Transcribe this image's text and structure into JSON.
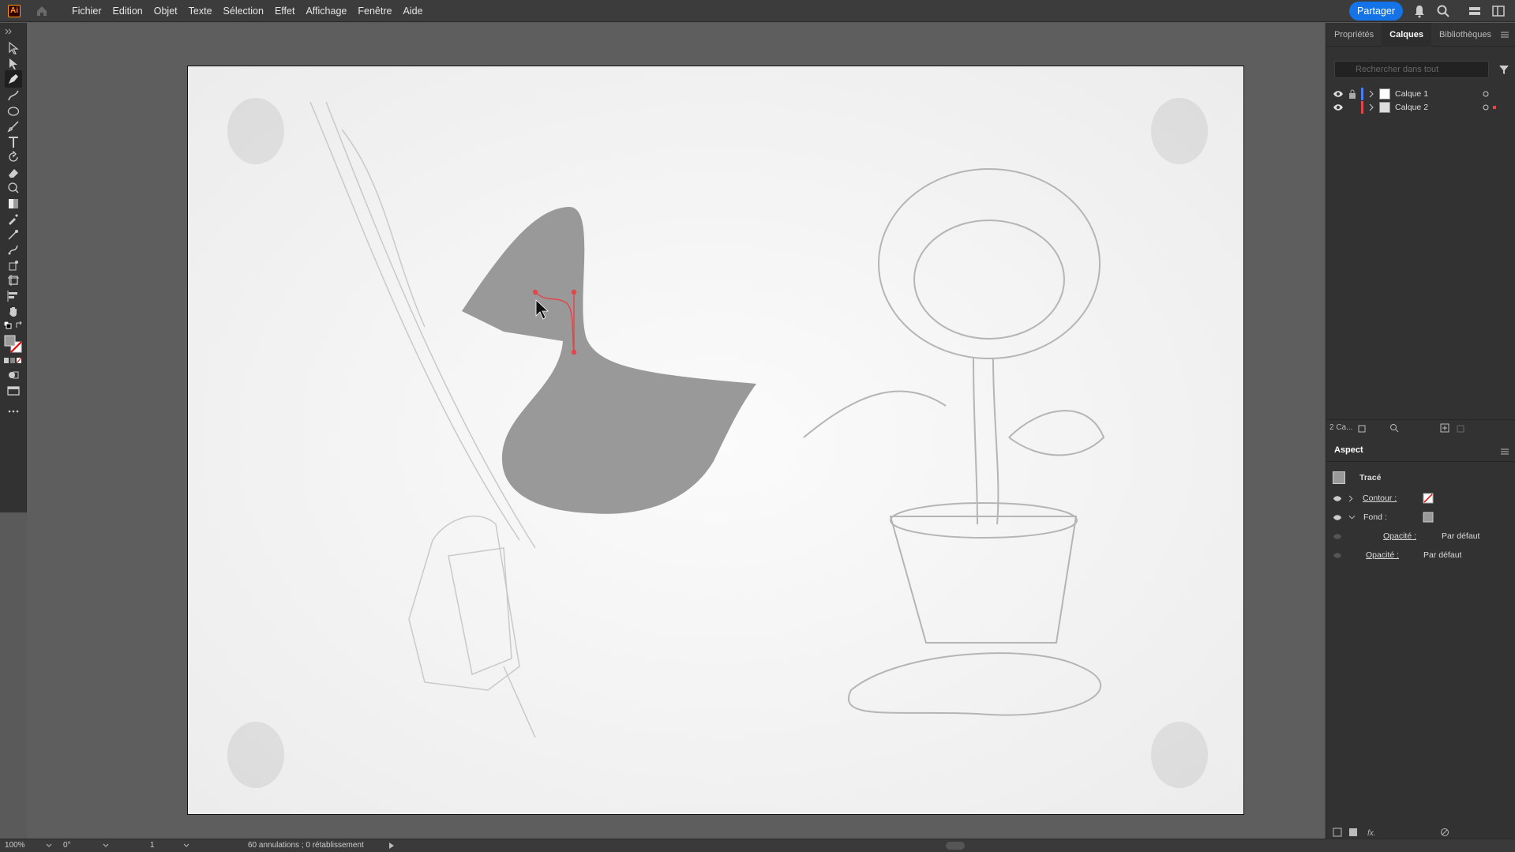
{
  "app": {
    "logo": "Ai"
  },
  "menu": [
    "Fichier",
    "Edition",
    "Objet",
    "Texte",
    "Sélection",
    "Effet",
    "Affichage",
    "Fenêtre",
    "Aide"
  ],
  "share_label": "Partager",
  "panel": {
    "tabs": [
      "Propriétés",
      "Calques",
      "Bibliothèques"
    ],
    "active_tab": "Calques",
    "search_placeholder": "Rechercher dans tout",
    "layers": [
      {
        "name": "Calque 1",
        "color": "#4b7bec"
      },
      {
        "name": "Calque 2",
        "color": "#e0474c"
      }
    ],
    "layers_count": "2 Ca..."
  },
  "aspect": {
    "title": "Aspect",
    "object": "Tracé",
    "contour_label": "Contour :",
    "fond_label": "Fond :",
    "opacity_label": "Opacité :",
    "opacity_value": "Par défaut",
    "opacity2_label": "Opacité :",
    "opacity2_value": "Par défaut"
  },
  "status": {
    "zoom": "100%",
    "rotation": "0°",
    "page": "1",
    "history": "60 annulations ; 0 rétablissement"
  },
  "colors": {
    "accent": "#1473e6",
    "fill_shape": "#999999",
    "path_selection": "#e0474c"
  },
  "icons": [
    "home-icon",
    "bell-icon",
    "search-icon",
    "arrange-icon",
    "workspace-icon",
    "filter-icon",
    "eye-icon",
    "lock-icon",
    "chevron-right-icon"
  ]
}
